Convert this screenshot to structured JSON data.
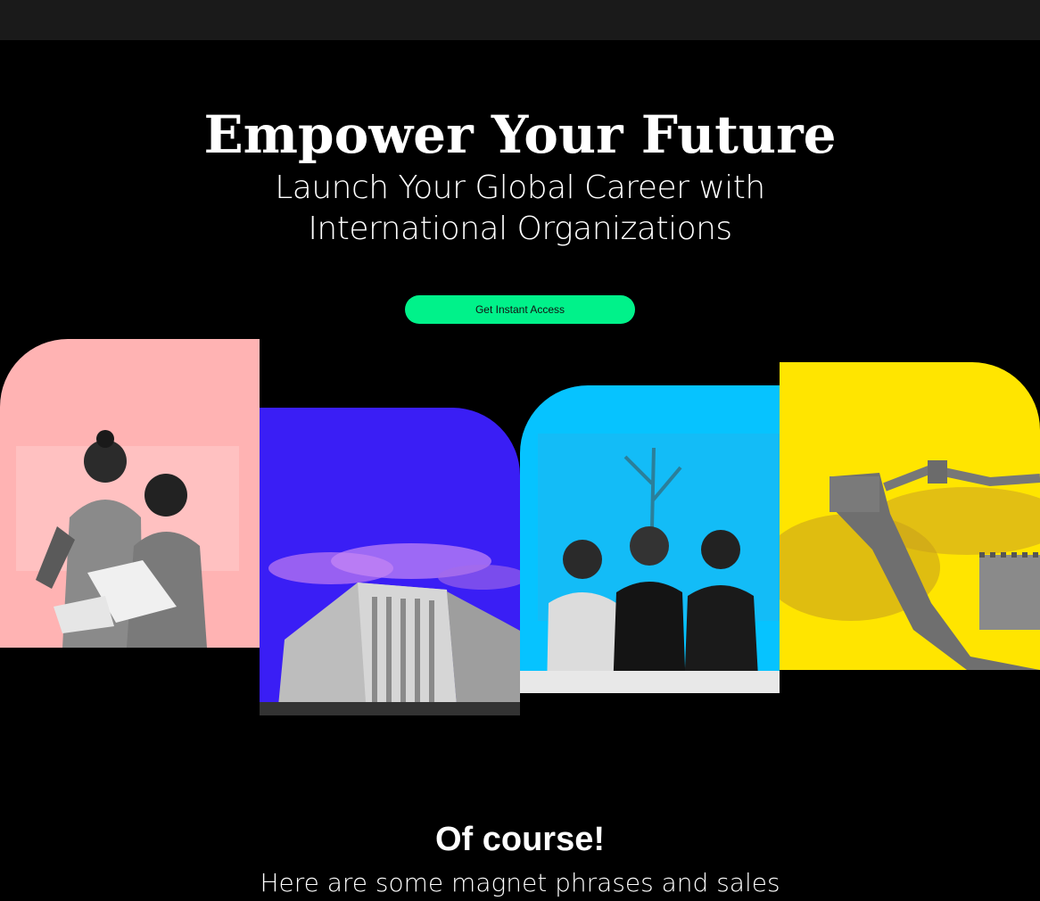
{
  "hero": {
    "title": "Empower Your Future",
    "subtitle": "Launch Your Global Career with International Organizations",
    "cta_label": "Get Instant Access"
  },
  "gallery": {
    "cards": [
      {
        "subject": "students-reading-photo",
        "bg_color": "#ffb3b3"
      },
      {
        "subject": "office-building-photo",
        "bg_color": "#3a1ef5"
      },
      {
        "subject": "group-of-friends-photo",
        "bg_color": "#06c3ff"
      },
      {
        "subject": "great-wall-photo",
        "bg_color": "#ffe500"
      }
    ]
  },
  "section": {
    "heading": "Of course!",
    "text": "Here are some magnet phrases and sales"
  },
  "colors": {
    "background": "#000000",
    "top_bar": "#1a1a1a",
    "accent": "#00f28a"
  }
}
